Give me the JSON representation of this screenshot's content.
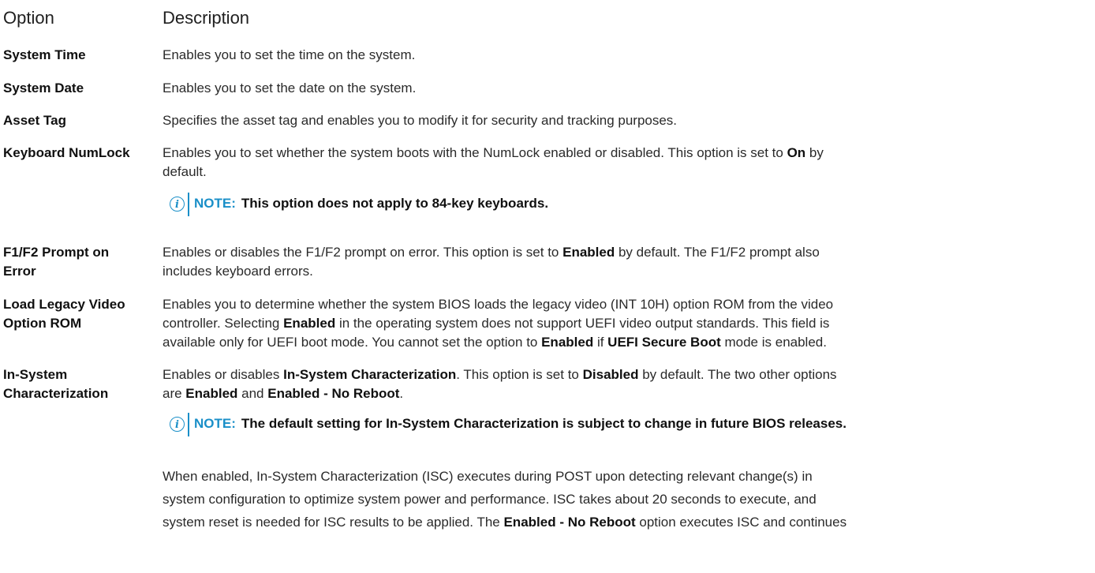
{
  "header": {
    "option": "Option",
    "description": "Description"
  },
  "rows": [
    {
      "label": "System Time",
      "desc": "Enables you to set the time on the system."
    },
    {
      "label": "System Date",
      "desc": "Enables you to set the date on the system."
    },
    {
      "label": "Asset Tag",
      "desc": "Specifies the asset tag and enables you to modify it for security and tracking purposes."
    },
    {
      "label": "Keyboard NumLock",
      "d1": "Enables you to set whether the system boots with the NumLock enabled or disabled. This option is set to ",
      "b1": "On",
      "d2": " by",
      "d3": "default."
    },
    {
      "label1": "F1/F2 Prompt on",
      "label2": "Error",
      "d1": "Enables or disables the F1/F2 prompt on error. This option is set to ",
      "b1": "Enabled",
      "d2": " by default. The F1/F2 prompt also",
      "d3": "includes keyboard errors."
    },
    {
      "label1": "Load Legacy Video",
      "label2": "Option ROM",
      "l1": "Enables you to determine whether the system BIOS loads the legacy video (INT 10H) option ROM from the video",
      "l2a": "controller. Selecting ",
      "l2b": "Enabled",
      "l2c": " in the operating system does not support UEFI video output standards. This field is",
      "l3a": "available only for UEFI boot mode. You cannot set the option to ",
      "l3b": "Enabled",
      "l3c": " if ",
      "l3d": "UEFI Secure Boot",
      "l3e": " mode is enabled."
    },
    {
      "label1": "In-System",
      "label2": "Characterization",
      "l1a": "Enables or disables ",
      "l1b": "In-System Characterization",
      "l1c": ". This option is set to ",
      "l1d": "Disabled",
      "l1e": " by default. The two other options",
      "l2a": "are ",
      "l2b": "Enabled",
      "l2c": " and ",
      "l2d": "Enabled - No Reboot",
      "l2e": "."
    }
  ],
  "notes": {
    "keyword": "NOTE:",
    "icon": "info-icon",
    "note1": "This option does not apply to 84-key keyboards.",
    "note2": "The default setting for In-System Characterization is subject to change in future BIOS releases."
  },
  "isc_para": {
    "l1": "When enabled, In-System Characterization (ISC) executes during POST upon detecting relevant change(s) in",
    "l2": "system configuration to optimize system power and performance. ISC takes about 20 seconds to execute, and",
    "l3a": "system reset is needed for ISC results to be applied. The ",
    "l3b": "Enabled - No Reboot",
    "l3c": " option executes ISC and continues"
  },
  "colors": {
    "accent": "#1a8fc8",
    "text": "#2a2a2a"
  }
}
